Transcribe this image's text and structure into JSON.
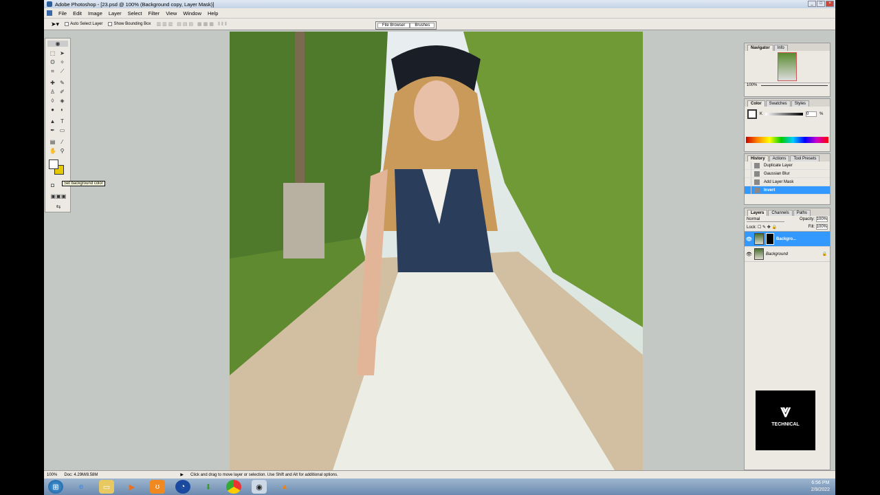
{
  "window": {
    "title": "Adobe Photoshop - [23.psd @ 100% (Background copy, Layer Mask)]"
  },
  "menu": [
    "File",
    "Edit",
    "Image",
    "Layer",
    "Select",
    "Filter",
    "View",
    "Window",
    "Help"
  ],
  "options": {
    "auto_select": "Auto Select Layer",
    "bounding_box": "Show Bounding Box"
  },
  "wells": [
    "File Browser",
    "Brushes"
  ],
  "tooltip": "Set background color",
  "navigator": {
    "tabs": [
      "Navigator",
      "Info"
    ],
    "zoom": "100%"
  },
  "color": {
    "tabs": [
      "Color",
      "Swatches",
      "Styles"
    ],
    "channel": "K",
    "value": "0",
    "unit": "%"
  },
  "history": {
    "tabs": [
      "History",
      "Actions",
      "Tool Presets"
    ],
    "items": [
      "Duplicate Layer",
      "Gaussian Blur",
      "Add Layer Mask",
      "Invert"
    ]
  },
  "layers": {
    "tabs": [
      "Layers",
      "Channels",
      "Paths"
    ],
    "blend": "Normal",
    "opacity_label": "Opacity:",
    "opacity": "100%",
    "lock_label": "Lock:",
    "fill_label": "Fill:",
    "fill": "100%",
    "items": [
      "Backgro...",
      "Background"
    ]
  },
  "status": {
    "zoom": "100%",
    "doc": "Doc: 4.29M/8.58M",
    "hint": "Click and drag to move layer or selection.  Use Shift and Alt for additional options."
  },
  "tray": {
    "time": "6:56 PM",
    "date": "2/9/2022"
  },
  "watermark": "TECHNICAL"
}
